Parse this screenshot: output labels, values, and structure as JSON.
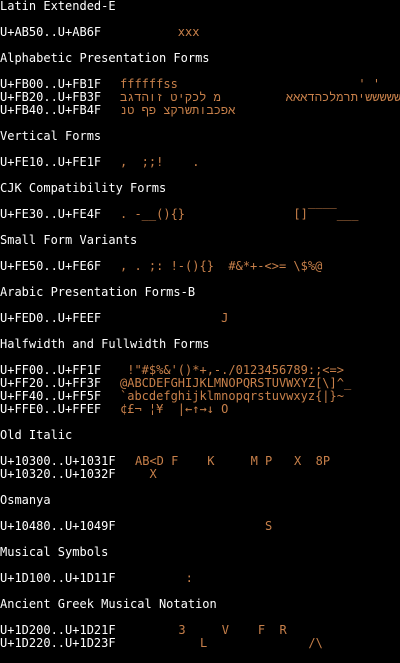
{
  "colors": {
    "background": "#000000",
    "heading_text": "#ffffff",
    "range_text": "#ffffff",
    "glyph_text": "#c8804a"
  },
  "sections": [
    {
      "title": "Latin Extended-E",
      "rows": [
        {
          "range": "U+AB50..U+AB6F",
          "glyphs": "        xxx"
        }
      ]
    },
    {
      "title": "Alphabetic Presentation Forms",
      "rows": [
        {
          "range": "U+FB00..U+FB1F",
          "glyphs": "ffffffss                         ' '"
        },
        {
          "range": "U+FB20..U+FB3F",
          "glyphs": "אאהלכדבגשששששיתרמלכהדאאא         מ לכקיט זוהדגב"
        },
        {
          "range": "U+FB40..U+FB4F",
          "glyphs": "אפכבותשרקצ פף טנ"
        }
      ]
    },
    {
      "title": "Vertical Forms",
      "rows": [
        {
          "range": "U+FE10..U+FE1F",
          "glyphs": ",  ;;!    ."
        }
      ]
    },
    {
      "title": "CJK Compatibility Forms",
      "rows": [
        {
          "range": "U+FE30..U+FE4F",
          "glyphs": ". -__(){}               []‾‾‾‾___"
        }
      ]
    },
    {
      "title": "Small Form Variants",
      "rows": [
        {
          "range": "U+FE50..U+FE6F",
          "glyphs": ", . ;: !-(){}  #&*+-<>= \\$%@"
        }
      ]
    },
    {
      "title": "Arabic Presentation Forms-B",
      "rows": [
        {
          "range": "U+FED0..U+FEEF",
          "glyphs": "              J"
        }
      ]
    },
    {
      "title": "Halfwidth and Fullwidth Forms",
      "rows": [
        {
          "range": "U+FF00..U+FF1F",
          "glyphs": " !\"#$%&'()*+,-./0123456789:;<=>"
        },
        {
          "range": "U+FF20..U+FF3F",
          "glyphs": "@ABCDEFGHIJKLMNOPQRSTUVWXYZ[\\]^_"
        },
        {
          "range": "U+FF40..U+FF5F",
          "glyphs": "`abcdefghijklmnopqrstuvwxyz{|}~"
        },
        {
          "range": "U+FFE0..U+FFEF",
          "glyphs": "¢£¬ ¦¥  |←↑→↓ O"
        }
      ]
    },
    {
      "title": "Old Italic",
      "rows": [
        {
          "range": "U+10300..U+1031F",
          "glyphs": "AB<D F    K     M P   X  8P"
        },
        {
          "range": "U+10320..U+1032F",
          "glyphs": "  X"
        }
      ]
    },
    {
      "title": "Osmanya",
      "rows": [
        {
          "range": "U+10480..U+1049F",
          "glyphs": "                  S"
        }
      ]
    },
    {
      "title": "Musical Symbols",
      "rows": [
        {
          "range": "U+1D100..U+1D11F",
          "glyphs": "       :"
        }
      ]
    },
    {
      "title": "Ancient Greek Musical Notation",
      "rows": [
        {
          "range": "U+1D200..U+1D21F",
          "glyphs": "      3     V    F  R"
        },
        {
          "range": "U+1D220..U+1D23F",
          "glyphs": "         L              /\\"
        }
      ]
    }
  ]
}
